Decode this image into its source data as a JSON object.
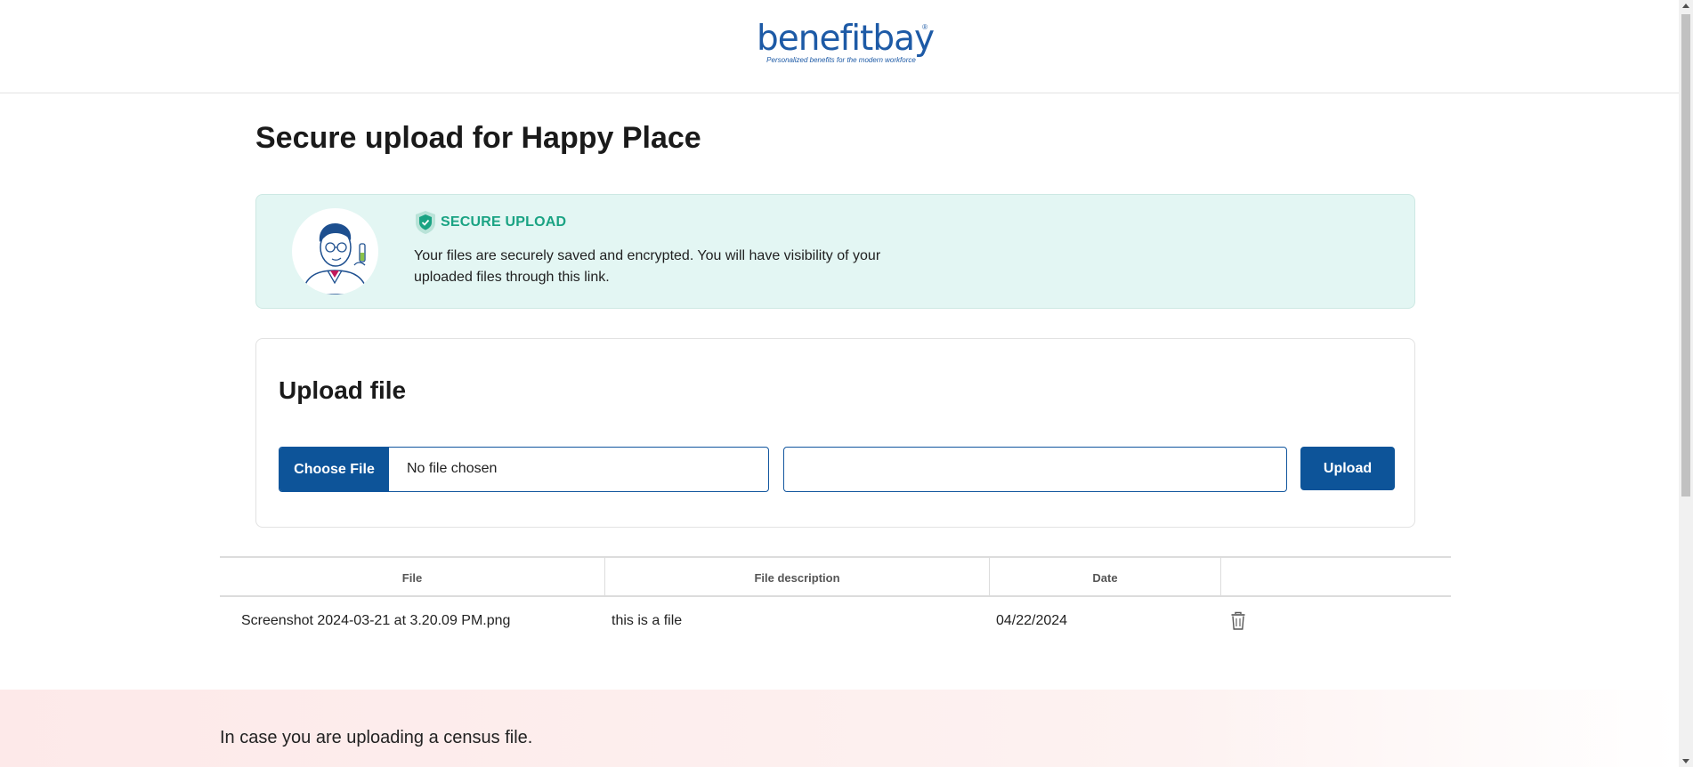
{
  "header": {
    "logo_text": "benefitbay",
    "logo_tagline": "Personalized benefits for the modern workforce",
    "logo_mark": "®"
  },
  "page": {
    "title": "Secure upload for Happy Place"
  },
  "banner": {
    "label": "SECURE UPLOAD",
    "text": "Your files are securely saved and encrypted. You will have visibility of your uploaded files through this link.",
    "icon": "shield-check-icon",
    "accent_color": "#1aa383",
    "background_color": "#e3f6f3"
  },
  "upload": {
    "title": "Upload file",
    "choose_label": "Choose File",
    "file_status": "No file chosen",
    "description_value": "",
    "upload_label": "Upload",
    "button_color": "#0d5499"
  },
  "table": {
    "columns": [
      "File",
      "File description",
      "Date",
      ""
    ],
    "rows": [
      {
        "file": "Screenshot 2024-03-21 at 3.20.09 PM.png",
        "description": "this is a file",
        "date": "04/22/2024",
        "action_icon": "trash-icon"
      }
    ]
  },
  "footer": {
    "text": "In case you are uploading a census file."
  }
}
